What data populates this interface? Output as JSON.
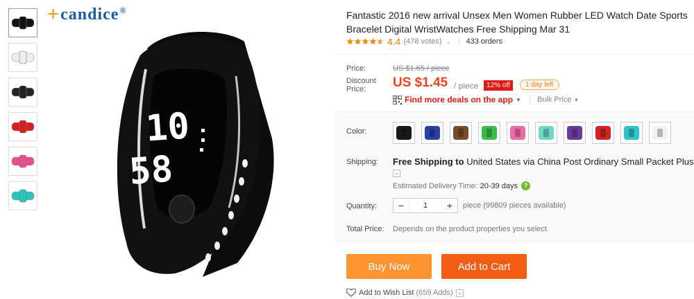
{
  "brand": {
    "name": "candice",
    "mark": "+",
    "registered": "®"
  },
  "thumbnails": [
    {
      "name": "black-watch",
      "color": "#111111",
      "active": true
    },
    {
      "name": "white-watch",
      "color": "#eeeeee",
      "active": false
    },
    {
      "name": "black-watch-side",
      "color": "#222222",
      "active": false
    },
    {
      "name": "red-watch",
      "color": "#d62020",
      "active": false
    },
    {
      "name": "pink-watch",
      "color": "#e84f8c",
      "active": false
    },
    {
      "name": "teal-watch",
      "color": "#2cc4c0",
      "active": false
    }
  ],
  "watch_display": {
    "top_digits": "10",
    "bottom_digits": "58"
  },
  "product": {
    "title": "Fantastic 2016 new arrival Unsex Men Women Rubber LED Watch Date Sports Bracelet Digital WristWatches Free Shipping Mar 31",
    "rating": "4.4",
    "votes": "(478 votes)",
    "orders": "433 orders"
  },
  "price": {
    "price_label": "Price:",
    "original": "US $1.65 / piece",
    "discount_label": "Discount Price:",
    "discount_value": "US $1.45",
    "per_piece": "/ piece",
    "off_badge": "12% off",
    "time_badge": "1 day left",
    "app_link": "Find more deals on the app",
    "bulk_price": "Bulk Price"
  },
  "options": {
    "color_label": "Color:",
    "colors": [
      {
        "name": "black",
        "hex": "#1a1a1a"
      },
      {
        "name": "blue",
        "hex": "#2a3fa8"
      },
      {
        "name": "brown",
        "hex": "#7a4a2a"
      },
      {
        "name": "green",
        "hex": "#3dbb4a"
      },
      {
        "name": "pink",
        "hex": "#ee6aa7"
      },
      {
        "name": "light-teal",
        "hex": "#6dd8c8"
      },
      {
        "name": "purple",
        "hex": "#6a3a9a"
      },
      {
        "name": "red",
        "hex": "#cf2525"
      },
      {
        "name": "cyan",
        "hex": "#2cc4c9"
      },
      {
        "name": "white",
        "hex": "#f2f2f2"
      }
    ],
    "shipping_label": "Shipping:",
    "shipping_free": "Free Shipping",
    "shipping_to": "to",
    "shipping_country": "United States",
    "shipping_via": "via China Post Ordinary Small Packet Plus",
    "eta_label": "Estimated Delivery Time:",
    "eta_value": "20-39 days",
    "quantity_label": "Quantity:",
    "quantity_value": "1",
    "quantity_minus": "−",
    "quantity_plus": "+",
    "availability": "piece (99809 pieces available)",
    "total_label": "Total Price:",
    "total_note": "Depends on the product properties you select"
  },
  "actions": {
    "buy_now": "Buy Now",
    "add_to_cart": "Add to Cart",
    "wish_list": "Add to Wish List",
    "wish_count": "(659 Adds)"
  }
}
